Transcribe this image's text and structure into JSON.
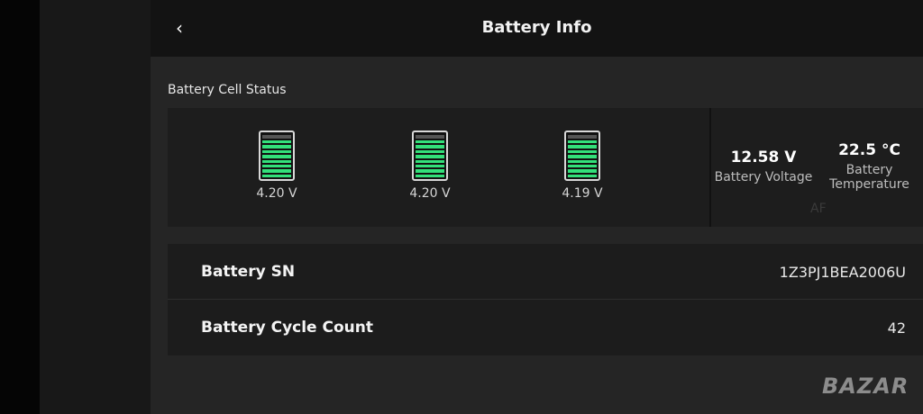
{
  "header": {
    "back_icon": "chevron-left-icon",
    "title": "Battery Info"
  },
  "cell_status": {
    "label": "Battery Cell Status",
    "accent_color": "#33e07a",
    "cells": [
      {
        "voltage": "4.20 V"
      },
      {
        "voltage": "4.20 V"
      },
      {
        "voltage": "4.19 V"
      }
    ]
  },
  "stats": {
    "voltage": {
      "value": "12.58 V",
      "label": "Battery Voltage"
    },
    "temperature": {
      "value": "22.5 °C",
      "label_line1": "Battery",
      "label_line2": "Temperature"
    },
    "overlay_text": "AF"
  },
  "info": {
    "sn": {
      "label": "Battery SN",
      "value": "1Z3PJ1BEA2006U"
    },
    "cycle": {
      "label": "Battery Cycle Count",
      "value": "42"
    }
  },
  "watermark": "BAZAR"
}
